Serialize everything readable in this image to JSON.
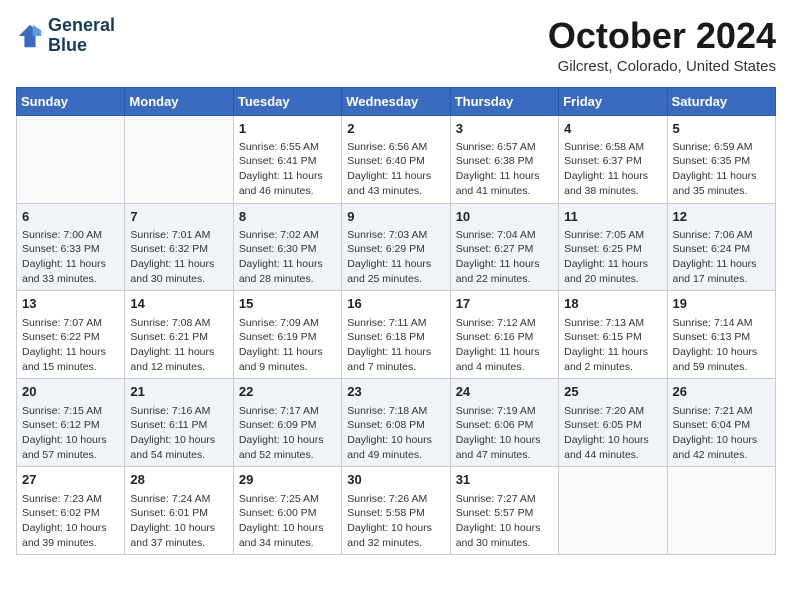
{
  "header": {
    "logo_line1": "General",
    "logo_line2": "Blue",
    "month": "October 2024",
    "location": "Gilcrest, Colorado, United States"
  },
  "weekdays": [
    "Sunday",
    "Monday",
    "Tuesday",
    "Wednesday",
    "Thursday",
    "Friday",
    "Saturday"
  ],
  "weeks": [
    [
      {
        "day": "",
        "info": ""
      },
      {
        "day": "",
        "info": ""
      },
      {
        "day": "1",
        "info": "Sunrise: 6:55 AM\nSunset: 6:41 PM\nDaylight: 11 hours and 46 minutes."
      },
      {
        "day": "2",
        "info": "Sunrise: 6:56 AM\nSunset: 6:40 PM\nDaylight: 11 hours and 43 minutes."
      },
      {
        "day": "3",
        "info": "Sunrise: 6:57 AM\nSunset: 6:38 PM\nDaylight: 11 hours and 41 minutes."
      },
      {
        "day": "4",
        "info": "Sunrise: 6:58 AM\nSunset: 6:37 PM\nDaylight: 11 hours and 38 minutes."
      },
      {
        "day": "5",
        "info": "Sunrise: 6:59 AM\nSunset: 6:35 PM\nDaylight: 11 hours and 35 minutes."
      }
    ],
    [
      {
        "day": "6",
        "info": "Sunrise: 7:00 AM\nSunset: 6:33 PM\nDaylight: 11 hours and 33 minutes."
      },
      {
        "day": "7",
        "info": "Sunrise: 7:01 AM\nSunset: 6:32 PM\nDaylight: 11 hours and 30 minutes."
      },
      {
        "day": "8",
        "info": "Sunrise: 7:02 AM\nSunset: 6:30 PM\nDaylight: 11 hours and 28 minutes."
      },
      {
        "day": "9",
        "info": "Sunrise: 7:03 AM\nSunset: 6:29 PM\nDaylight: 11 hours and 25 minutes."
      },
      {
        "day": "10",
        "info": "Sunrise: 7:04 AM\nSunset: 6:27 PM\nDaylight: 11 hours and 22 minutes."
      },
      {
        "day": "11",
        "info": "Sunrise: 7:05 AM\nSunset: 6:25 PM\nDaylight: 11 hours and 20 minutes."
      },
      {
        "day": "12",
        "info": "Sunrise: 7:06 AM\nSunset: 6:24 PM\nDaylight: 11 hours and 17 minutes."
      }
    ],
    [
      {
        "day": "13",
        "info": "Sunrise: 7:07 AM\nSunset: 6:22 PM\nDaylight: 11 hours and 15 minutes."
      },
      {
        "day": "14",
        "info": "Sunrise: 7:08 AM\nSunset: 6:21 PM\nDaylight: 11 hours and 12 minutes."
      },
      {
        "day": "15",
        "info": "Sunrise: 7:09 AM\nSunset: 6:19 PM\nDaylight: 11 hours and 9 minutes."
      },
      {
        "day": "16",
        "info": "Sunrise: 7:11 AM\nSunset: 6:18 PM\nDaylight: 11 hours and 7 minutes."
      },
      {
        "day": "17",
        "info": "Sunrise: 7:12 AM\nSunset: 6:16 PM\nDaylight: 11 hours and 4 minutes."
      },
      {
        "day": "18",
        "info": "Sunrise: 7:13 AM\nSunset: 6:15 PM\nDaylight: 11 hours and 2 minutes."
      },
      {
        "day": "19",
        "info": "Sunrise: 7:14 AM\nSunset: 6:13 PM\nDaylight: 10 hours and 59 minutes."
      }
    ],
    [
      {
        "day": "20",
        "info": "Sunrise: 7:15 AM\nSunset: 6:12 PM\nDaylight: 10 hours and 57 minutes."
      },
      {
        "day": "21",
        "info": "Sunrise: 7:16 AM\nSunset: 6:11 PM\nDaylight: 10 hours and 54 minutes."
      },
      {
        "day": "22",
        "info": "Sunrise: 7:17 AM\nSunset: 6:09 PM\nDaylight: 10 hours and 52 minutes."
      },
      {
        "day": "23",
        "info": "Sunrise: 7:18 AM\nSunset: 6:08 PM\nDaylight: 10 hours and 49 minutes."
      },
      {
        "day": "24",
        "info": "Sunrise: 7:19 AM\nSunset: 6:06 PM\nDaylight: 10 hours and 47 minutes."
      },
      {
        "day": "25",
        "info": "Sunrise: 7:20 AM\nSunset: 6:05 PM\nDaylight: 10 hours and 44 minutes."
      },
      {
        "day": "26",
        "info": "Sunrise: 7:21 AM\nSunset: 6:04 PM\nDaylight: 10 hours and 42 minutes."
      }
    ],
    [
      {
        "day": "27",
        "info": "Sunrise: 7:23 AM\nSunset: 6:02 PM\nDaylight: 10 hours and 39 minutes."
      },
      {
        "day": "28",
        "info": "Sunrise: 7:24 AM\nSunset: 6:01 PM\nDaylight: 10 hours and 37 minutes."
      },
      {
        "day": "29",
        "info": "Sunrise: 7:25 AM\nSunset: 6:00 PM\nDaylight: 10 hours and 34 minutes."
      },
      {
        "day": "30",
        "info": "Sunrise: 7:26 AM\nSunset: 5:58 PM\nDaylight: 10 hours and 32 minutes."
      },
      {
        "day": "31",
        "info": "Sunrise: 7:27 AM\nSunset: 5:57 PM\nDaylight: 10 hours and 30 minutes."
      },
      {
        "day": "",
        "info": ""
      },
      {
        "day": "",
        "info": ""
      }
    ]
  ]
}
